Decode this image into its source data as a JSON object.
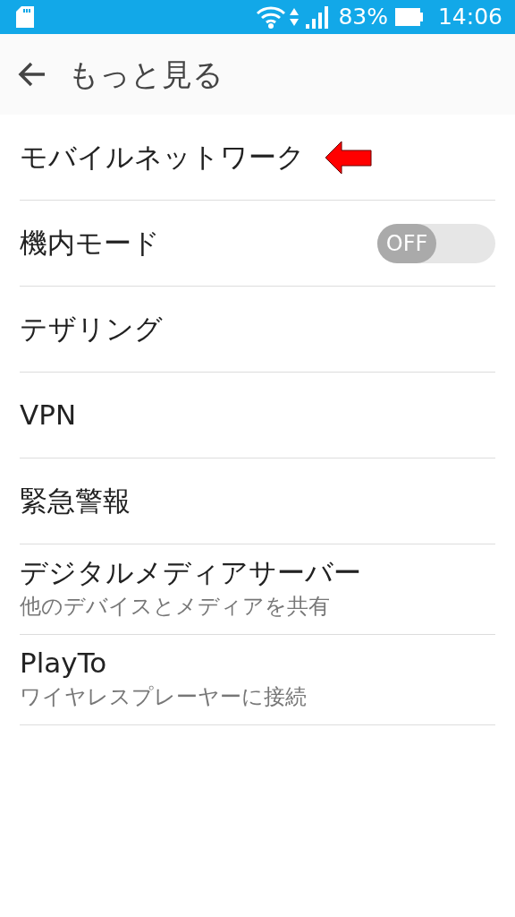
{
  "status_bar": {
    "battery": "83%",
    "time": "14:06"
  },
  "header": {
    "title": "もっと見る"
  },
  "items": [
    {
      "kind": "plain",
      "title": "モバイルネットワーク",
      "pointed": true
    },
    {
      "kind": "toggle",
      "title": "機内モード",
      "on": false,
      "toggle_label": "OFF"
    },
    {
      "kind": "plain",
      "title": "テザリング"
    },
    {
      "kind": "plain",
      "title": "VPN"
    },
    {
      "kind": "plain",
      "title": "緊急警報"
    },
    {
      "kind": "subtitle",
      "title": "デジタルメディアサーバー",
      "subtitle": "他のデバイスとメディアを共有"
    },
    {
      "kind": "subtitle",
      "title": "PlayTo",
      "subtitle": "ワイヤレスプレーヤーに接続"
    }
  ]
}
